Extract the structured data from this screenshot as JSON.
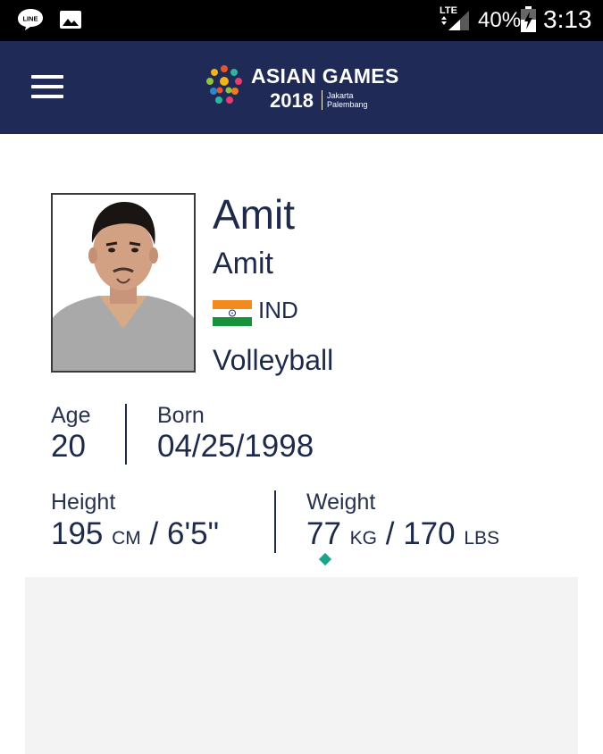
{
  "status_bar": {
    "network": "LTE",
    "battery_percent": "40%",
    "time": "3:13",
    "left_icons": [
      "line-app-icon",
      "gallery-icon"
    ]
  },
  "header": {
    "logo_title": "ASIAN GAMES",
    "logo_year": "2018",
    "logo_city_line1": "Jakarta",
    "logo_city_line2": "Palembang",
    "menu_icon": "hamburger-menu-icon",
    "colors": {
      "background": "#1f2a56",
      "text": "#ffffff"
    }
  },
  "athlete": {
    "name": "Amit",
    "full_name": "Amit",
    "country_code": "IND",
    "sport": "Volleyball",
    "age_label": "Age",
    "age_value": "20",
    "born_label": "Born",
    "born_value": "04/25/1998",
    "height_label": "Height",
    "height_cm": "195",
    "height_cm_unit": "CM",
    "height_sep": "/",
    "height_ft": "6'5\"",
    "weight_label": "Weight",
    "weight_kg": "77",
    "weight_kg_unit": "KG",
    "weight_sep": "/",
    "weight_lbs": "170",
    "weight_lbs_unit": "LBS"
  },
  "colors": {
    "text_primary": "#1e2a4a",
    "accent_dot": "#1aa58a",
    "panel_grey": "#f3f3f3"
  }
}
